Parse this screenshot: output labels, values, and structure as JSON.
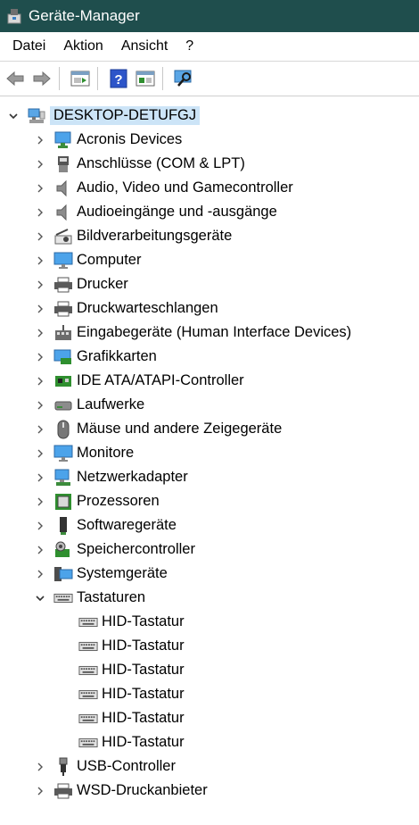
{
  "window": {
    "title": "Geräte-Manager",
    "icon": "device-manager-icon"
  },
  "menu": [
    "Datei",
    "Aktion",
    "Ansicht",
    "?"
  ],
  "toolbar": [
    "back-arrow-icon",
    "forward-arrow-icon",
    "properties-icon",
    "help-icon",
    "details-pane-icon",
    "scan-hardware-icon"
  ],
  "tree": {
    "root": {
      "label": "DESKTOP-DETUFGJ",
      "icon": "computer-network-icon",
      "expanded": true
    },
    "categories": [
      {
        "label": "Acronis Devices",
        "icon": "monitor-network-icon"
      },
      {
        "label": "Anschlüsse (COM & LPT)",
        "icon": "port-icon"
      },
      {
        "label": "Audio, Video und Gamecontroller",
        "icon": "speaker-icon"
      },
      {
        "label": "Audioeingänge und -ausgänge",
        "icon": "speaker-icon"
      },
      {
        "label": "Bildverarbeitungsgeräte",
        "icon": "camera-icon"
      },
      {
        "label": "Computer",
        "icon": "monitor-icon"
      },
      {
        "label": "Drucker",
        "icon": "printer-icon"
      },
      {
        "label": "Druckwarteschlangen",
        "icon": "printer-icon"
      },
      {
        "label": "Eingabegeräte (Human Interface Devices)",
        "icon": "hid-icon"
      },
      {
        "label": "Grafikkarten",
        "icon": "display-adapter-icon"
      },
      {
        "label": "IDE ATA/ATAPI-Controller",
        "icon": "controller-card-icon"
      },
      {
        "label": "Laufwerke",
        "icon": "disk-drive-icon"
      },
      {
        "label": "Mäuse und andere Zeigegeräte",
        "icon": "mouse-icon"
      },
      {
        "label": "Monitore",
        "icon": "monitor-icon"
      },
      {
        "label": "Netzwerkadapter",
        "icon": "network-adapter-icon"
      },
      {
        "label": "Prozessoren",
        "icon": "processor-icon"
      },
      {
        "label": "Softwaregeräte",
        "icon": "software-device-icon"
      },
      {
        "label": "Speichercontroller",
        "icon": "storage-controller-icon"
      },
      {
        "label": "Systemgeräte",
        "icon": "system-device-icon"
      },
      {
        "label": "Tastaturen",
        "icon": "keyboard-icon",
        "expanded": true,
        "children": [
          "HID-Tastatur",
          "HID-Tastatur",
          "HID-Tastatur",
          "HID-Tastatur",
          "HID-Tastatur",
          "HID-Tastatur"
        ]
      },
      {
        "label": "USB-Controller",
        "icon": "usb-icon"
      },
      {
        "label": "WSD-Druckanbieter",
        "icon": "printer-icon"
      }
    ]
  },
  "colors": {
    "titlebar": "#1f4e4d",
    "selection": "#cce4f7"
  }
}
